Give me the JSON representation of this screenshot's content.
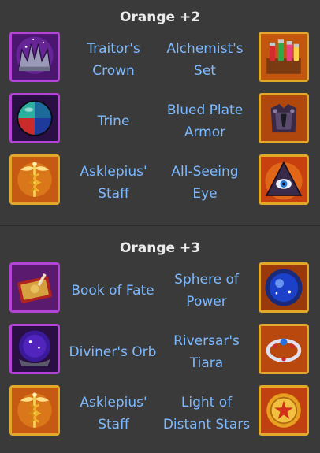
{
  "sections": [
    {
      "title": "Orange +2",
      "rows": [
        {
          "left": "Traitor's Crown",
          "left_l1": "Traitor's",
          "left_l2": "Crown",
          "right_l1": "Alchemist's",
          "right_l2": "Set"
        },
        {
          "left_l1": "Trine",
          "right_l1": "Blued Plate",
          "right_l2": "Armor"
        },
        {
          "left_l1": "Asklepius'",
          "left_l2": "Staff",
          "right_l1": "All-Seeing",
          "right_l2": "Eye"
        }
      ]
    },
    {
      "title": "Orange +3",
      "rows": [
        {
          "left_l1": "Book of Fate",
          "right_l1": "Sphere of",
          "right_l2": "Power"
        },
        {
          "left_l1": "Diviner's Orb",
          "right_l1": "Riversar's",
          "right_l2": "Tiara"
        },
        {
          "left_l1": "Asklepius'",
          "left_l2": "Staff",
          "right_l1": "Light of",
          "right_l2": "Distant Stars"
        }
      ]
    }
  ],
  "icons": {
    "s1r1_left": "crown-icon",
    "s1r1_right": "potion-set-icon",
    "s1r2_left": "orb-icon",
    "s1r2_right": "armor-icon",
    "s1r3_left": "caduceus-icon",
    "s1r3_right": "pyramid-eye-icon",
    "s2r1_left": "book-icon",
    "s2r1_right": "sphere-icon",
    "s2r2_left": "orb-icon",
    "s2r2_right": "tiara-icon",
    "s2r3_left": "caduceus-icon",
    "s2r3_right": "coin-star-icon"
  },
  "colors": {
    "background": "#3a3a3a",
    "title": "#ececec",
    "label": "#7db9ff",
    "purple_frame": "#b244d6",
    "gold_frame": "#e2a82a"
  }
}
